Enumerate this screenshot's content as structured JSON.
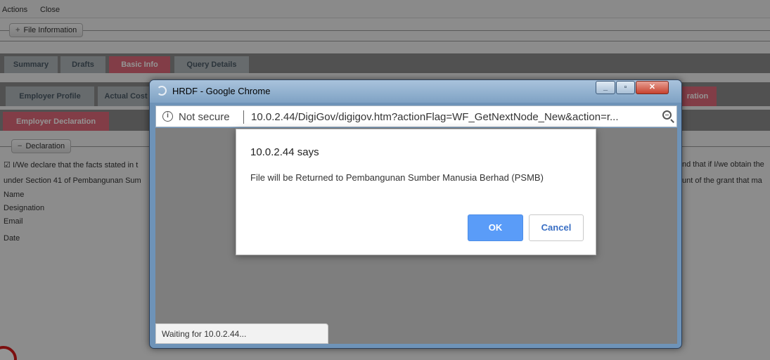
{
  "menu": {
    "actions": "Actions",
    "close": "Close"
  },
  "file_info_label": "File Information",
  "main_tabs": [
    "Summary",
    "Drafts",
    "Basic Info",
    "Query Details"
  ],
  "sub_tabs": {
    "employer_profile": "Employer Profile",
    "actual_cost": "Actual Cost",
    "partial_right": "ration"
  },
  "sub_tab2": "Employer Declaration",
  "declaration_label": "Declaration",
  "declaration_text": {
    "line1_left": "I/We declare that the facts stated in t",
    "line1_right": "nd that if I/we obtain the",
    "line2_left": "under Section 41 of Pembangunan Sum",
    "line2_right": "unt of the grant that ma"
  },
  "fields": [
    "Name",
    "Designation",
    "Email",
    "Date"
  ],
  "popup": {
    "title": "HRDF - Google Chrome",
    "not_secure": "Not secure",
    "url": "10.0.2.44/DigiGov/digigov.htm?actionFlag=WF_GetNextNode_New&action=r...",
    "status": "Waiting for 10.0.2.44..."
  },
  "dialog": {
    "title": "10.0.2.44 says",
    "message": "File will be Returned to Pembangunan Sumber Manusia Berhad (PSMB)",
    "ok_label": "OK",
    "cancel_label": "Cancel"
  }
}
